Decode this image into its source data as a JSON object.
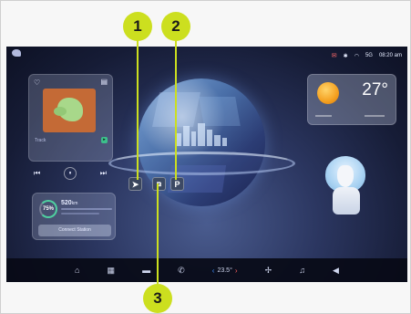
{
  "status_bar": {
    "icons": [
      "message-icon",
      "bluetooth-icon",
      "wifi-icon",
      "signal-icon"
    ],
    "signal_label": "5G",
    "time": "08:20 am"
  },
  "media": {
    "track": "Track",
    "controls": {
      "previous": "⏮",
      "play_pause": "⏸",
      "next": "⏭"
    }
  },
  "charge": {
    "percent": "75",
    "percent_suffix": "%",
    "range": "520",
    "range_unit": "km",
    "button_label": "Connect Station"
  },
  "weather": {
    "temperature": "27°"
  },
  "overlays": {
    "navigation": "➤",
    "camera": "⧉",
    "parking": "P"
  },
  "taskbar": {
    "icons": [
      "home-icon",
      "apps-icon",
      "car-icon",
      "phone-icon",
      "climate-icon",
      "fan-icon",
      "music-icon",
      "volume-icon"
    ],
    "temperature": "23.5°"
  },
  "callouts": {
    "one": "1",
    "two": "2",
    "three": "3"
  },
  "colors": {
    "callout": "#ccdf1f",
    "charge_ring": "#4fd0a0",
    "sun": "#f4a020",
    "album": "#c46a36"
  }
}
